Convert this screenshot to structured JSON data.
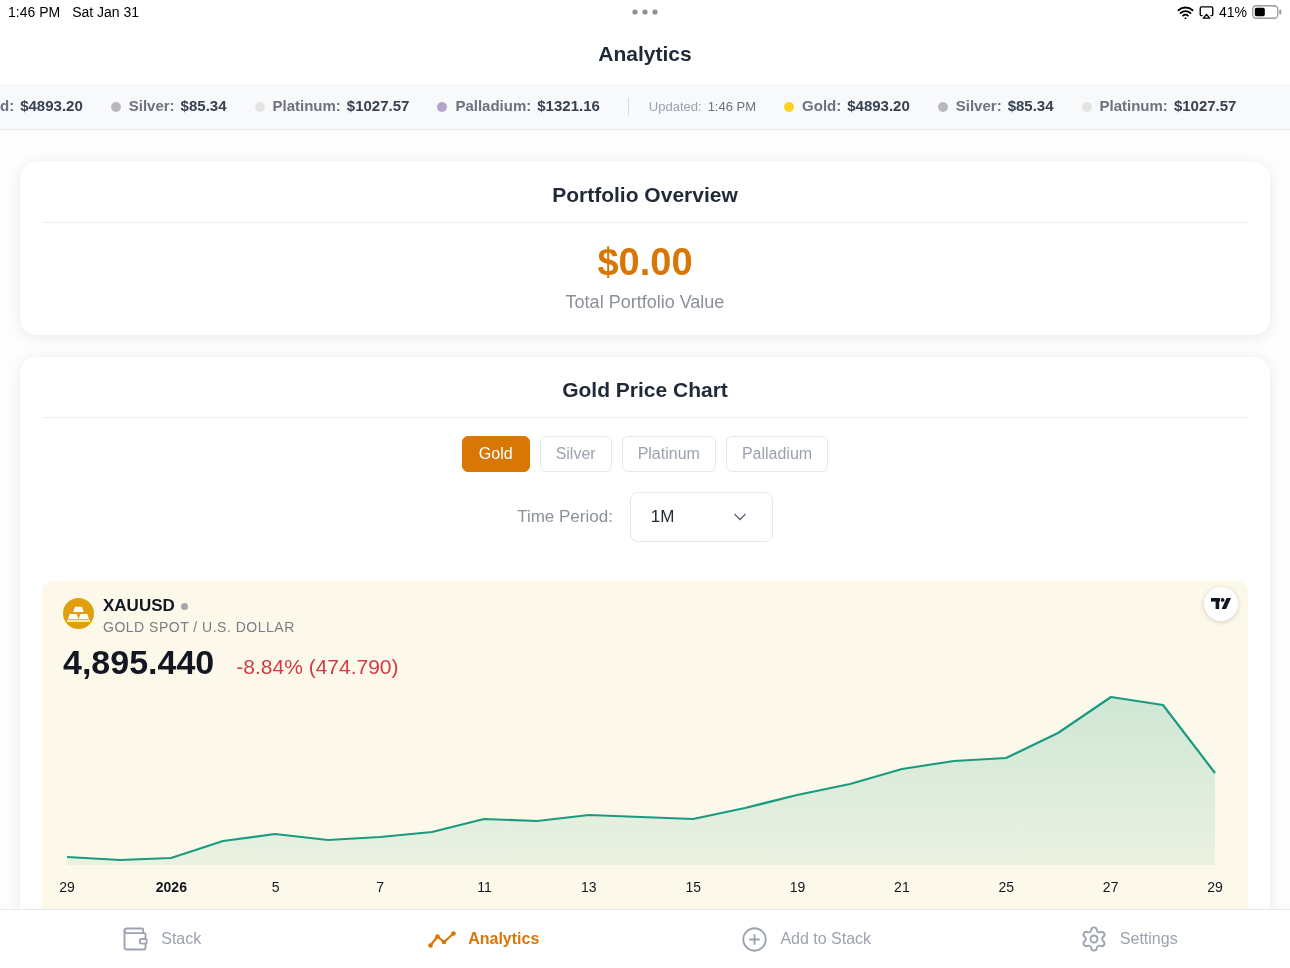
{
  "status_bar": {
    "time": "1:46 PM",
    "date": "Sat Jan 31",
    "battery": "41%"
  },
  "title": "Analytics",
  "ticker": [
    {
      "kind": "price",
      "label": "d:",
      "value": "$4893.20"
    },
    {
      "kind": "price",
      "label": "Silver:",
      "value": "$85.34",
      "color": "#b9b9bd"
    },
    {
      "kind": "price",
      "label": "Platinum:",
      "value": "$1027.57",
      "color": "#e4e4e4"
    },
    {
      "kind": "price",
      "label": "Palladium:",
      "value": "$1321.16",
      "color": "#b4a4cc"
    },
    {
      "kind": "updated",
      "label": "Updated:",
      "value": "1:46 PM"
    },
    {
      "kind": "price",
      "label": "Gold:",
      "value": "$4893.20",
      "color": "#ffd21f"
    },
    {
      "kind": "price",
      "label": "Silver:",
      "value": "$85.34",
      "color": "#b9b9bd"
    },
    {
      "kind": "price",
      "label": "Platinum:",
      "value": "$1027.57",
      "color": "#e4e4e4"
    }
  ],
  "portfolio": {
    "title": "Portfolio Overview",
    "value": "$0.00",
    "caption": "Total Portfolio Value"
  },
  "chart_card": {
    "title": "Gold Price Chart",
    "metal_tabs": [
      {
        "label": "Gold",
        "selected": true
      },
      {
        "label": "Silver",
        "selected": false
      },
      {
        "label": "Platinum",
        "selected": false
      },
      {
        "label": "Palladium",
        "selected": false
      }
    ],
    "time_period": {
      "label": "Time Period:",
      "value": "1M"
    },
    "widget": {
      "symbol": "XAUUSD",
      "description": "GOLD SPOT / U.S. DOLLAR",
      "price": "4,895.440",
      "change": "-8.84% (474.790)",
      "x_labels": [
        {
          "kind": "day",
          "label": "29"
        },
        {
          "kind": "year",
          "label": "2026"
        },
        {
          "kind": "day",
          "label": "5"
        },
        {
          "kind": "day",
          "label": "7"
        },
        {
          "kind": "day",
          "label": "11"
        },
        {
          "kind": "day",
          "label": "13"
        },
        {
          "kind": "day",
          "label": "15"
        },
        {
          "kind": "day",
          "label": "19"
        },
        {
          "kind": "day",
          "label": "21"
        },
        {
          "kind": "day",
          "label": "25"
        },
        {
          "kind": "day",
          "label": "27"
        },
        {
          "kind": "day",
          "label": "29"
        }
      ]
    }
  },
  "tab_bar": [
    {
      "label": "Stack",
      "selected": false
    },
    {
      "label": "Analytics",
      "selected": true
    },
    {
      "label": "Add to Stack",
      "selected": false
    },
    {
      "label": "Settings",
      "selected": false
    }
  ]
}
